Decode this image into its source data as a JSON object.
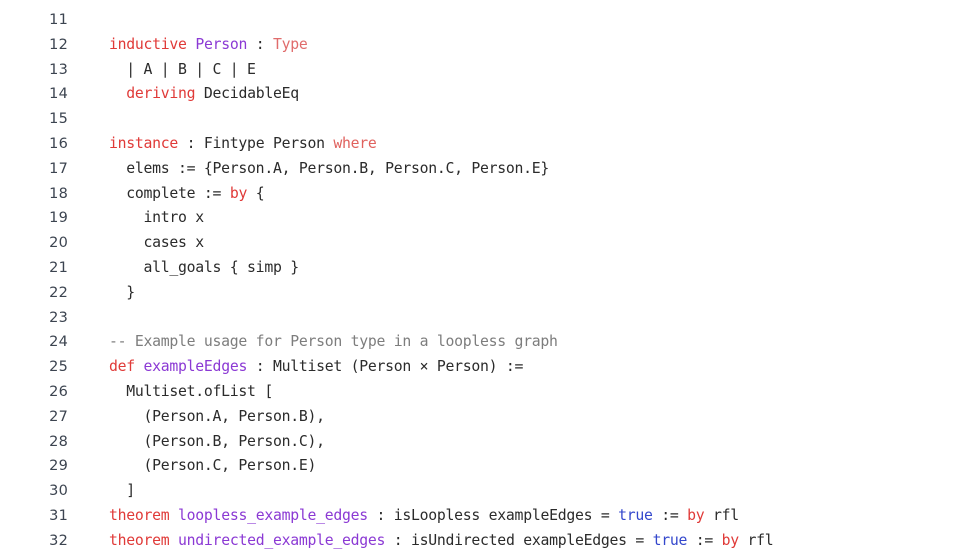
{
  "editor": {
    "language": "Lean 4",
    "background_color": "#ffffff",
    "gutter_color": "#3c4450",
    "first_visible_line": 11,
    "last_visible_line": 32,
    "token_colors": {
      "keyword": "#e03a38",
      "keyword_soft": "#e0625e",
      "declaration_name": "#8b39d4",
      "type": "#e06c6c",
      "constant": "#3347cc",
      "comment": "#7d7d7d",
      "plain": "#2b2b2b"
    },
    "lines": [
      {
        "number": "11",
        "text": "",
        "tokens": []
      },
      {
        "number": "12",
        "text": "inductive Person : Type",
        "tokens": [
          [
            "inductive",
            "tok-keyword"
          ],
          [
            " ",
            "tok-plain"
          ],
          [
            "Person",
            "tok-name"
          ],
          [
            " : ",
            "tok-plain"
          ],
          [
            "Type",
            "tok-type"
          ]
        ]
      },
      {
        "number": "13",
        "text": "  | A | B | C | E",
        "tokens": [
          [
            "  | A | B | C | E",
            "tok-plain"
          ]
        ]
      },
      {
        "number": "14",
        "text": "  deriving DecidableEq",
        "tokens": [
          [
            "  ",
            "tok-plain"
          ],
          [
            "deriving",
            "tok-keyword"
          ],
          [
            " DecidableEq",
            "tok-plain"
          ]
        ]
      },
      {
        "number": "15",
        "text": "",
        "tokens": []
      },
      {
        "number": "16",
        "text": "instance : Fintype Person where",
        "tokens": [
          [
            "instance",
            "tok-keyword"
          ],
          [
            " : Fintype Person ",
            "tok-plain"
          ],
          [
            "where",
            "tok-keyword2"
          ]
        ]
      },
      {
        "number": "17",
        "text": "  elems := {Person.A, Person.B, Person.C, Person.E}",
        "tokens": [
          [
            "  elems := {Person.A, Person.B, Person.C, Person.E}",
            "tok-plain"
          ]
        ]
      },
      {
        "number": "18",
        "text": "  complete := by {",
        "tokens": [
          [
            "  complete := ",
            "tok-plain"
          ],
          [
            "by",
            "tok-keyword"
          ],
          [
            " {",
            "tok-plain"
          ]
        ]
      },
      {
        "number": "19",
        "text": "    intro x",
        "tokens": [
          [
            "    intro x",
            "tok-plain"
          ]
        ]
      },
      {
        "number": "20",
        "text": "    cases x",
        "tokens": [
          [
            "    cases x",
            "tok-plain"
          ]
        ]
      },
      {
        "number": "21",
        "text": "    all_goals { simp }",
        "tokens": [
          [
            "    all_goals { simp }",
            "tok-plain"
          ]
        ]
      },
      {
        "number": "22",
        "text": "  }",
        "tokens": [
          [
            "  }",
            "tok-plain"
          ]
        ]
      },
      {
        "number": "23",
        "text": "",
        "tokens": []
      },
      {
        "number": "24",
        "text": "-- Example usage for Person type in a loopless graph",
        "tokens": [
          [
            "-- Example usage for Person type in a loopless graph",
            "tok-comment"
          ]
        ]
      },
      {
        "number": "25",
        "text": "def exampleEdges : Multiset (Person × Person) :=",
        "tokens": [
          [
            "def",
            "tok-keyword"
          ],
          [
            " ",
            "tok-plain"
          ],
          [
            "exampleEdges",
            "tok-name"
          ],
          [
            " : Multiset (Person × Person) :=",
            "tok-plain"
          ]
        ]
      },
      {
        "number": "26",
        "text": "  Multiset.ofList [",
        "tokens": [
          [
            "  Multiset.ofList [",
            "tok-plain"
          ]
        ]
      },
      {
        "number": "27",
        "text": "    (Person.A, Person.B),",
        "tokens": [
          [
            "    (Person.A, Person.B),",
            "tok-plain"
          ]
        ]
      },
      {
        "number": "28",
        "text": "    (Person.B, Person.C),",
        "tokens": [
          [
            "    (Person.B, Person.C),",
            "tok-plain"
          ]
        ]
      },
      {
        "number": "29",
        "text": "    (Person.C, Person.E)",
        "tokens": [
          [
            "    (Person.C, Person.E)",
            "tok-plain"
          ]
        ]
      },
      {
        "number": "30",
        "text": "  ]",
        "tokens": [
          [
            "  ]",
            "tok-plain"
          ]
        ]
      },
      {
        "number": "31",
        "text": "theorem loopless_example_edges : isLoopless exampleEdges = true := by rfl",
        "tokens": [
          [
            "theorem",
            "tok-keyword"
          ],
          [
            " ",
            "tok-plain"
          ],
          [
            "loopless_example_edges",
            "tok-name"
          ],
          [
            " : isLoopless exampleEdges = ",
            "tok-plain"
          ],
          [
            "true",
            "tok-const"
          ],
          [
            " := ",
            "tok-plain"
          ],
          [
            "by",
            "tok-keyword"
          ],
          [
            " rfl",
            "tok-plain"
          ]
        ]
      },
      {
        "number": "32",
        "text": "theorem undirected_example_edges : isUndirected exampleEdges = true := by rfl",
        "tokens": [
          [
            "theorem",
            "tok-keyword"
          ],
          [
            " ",
            "tok-plain"
          ],
          [
            "undirected_example_edges",
            "tok-name"
          ],
          [
            " : isUndirected exampleEdges = ",
            "tok-plain"
          ],
          [
            "true",
            "tok-const"
          ],
          [
            " := ",
            "tok-plain"
          ],
          [
            "by",
            "tok-keyword"
          ],
          [
            " rfl",
            "tok-plain"
          ]
        ]
      }
    ]
  }
}
